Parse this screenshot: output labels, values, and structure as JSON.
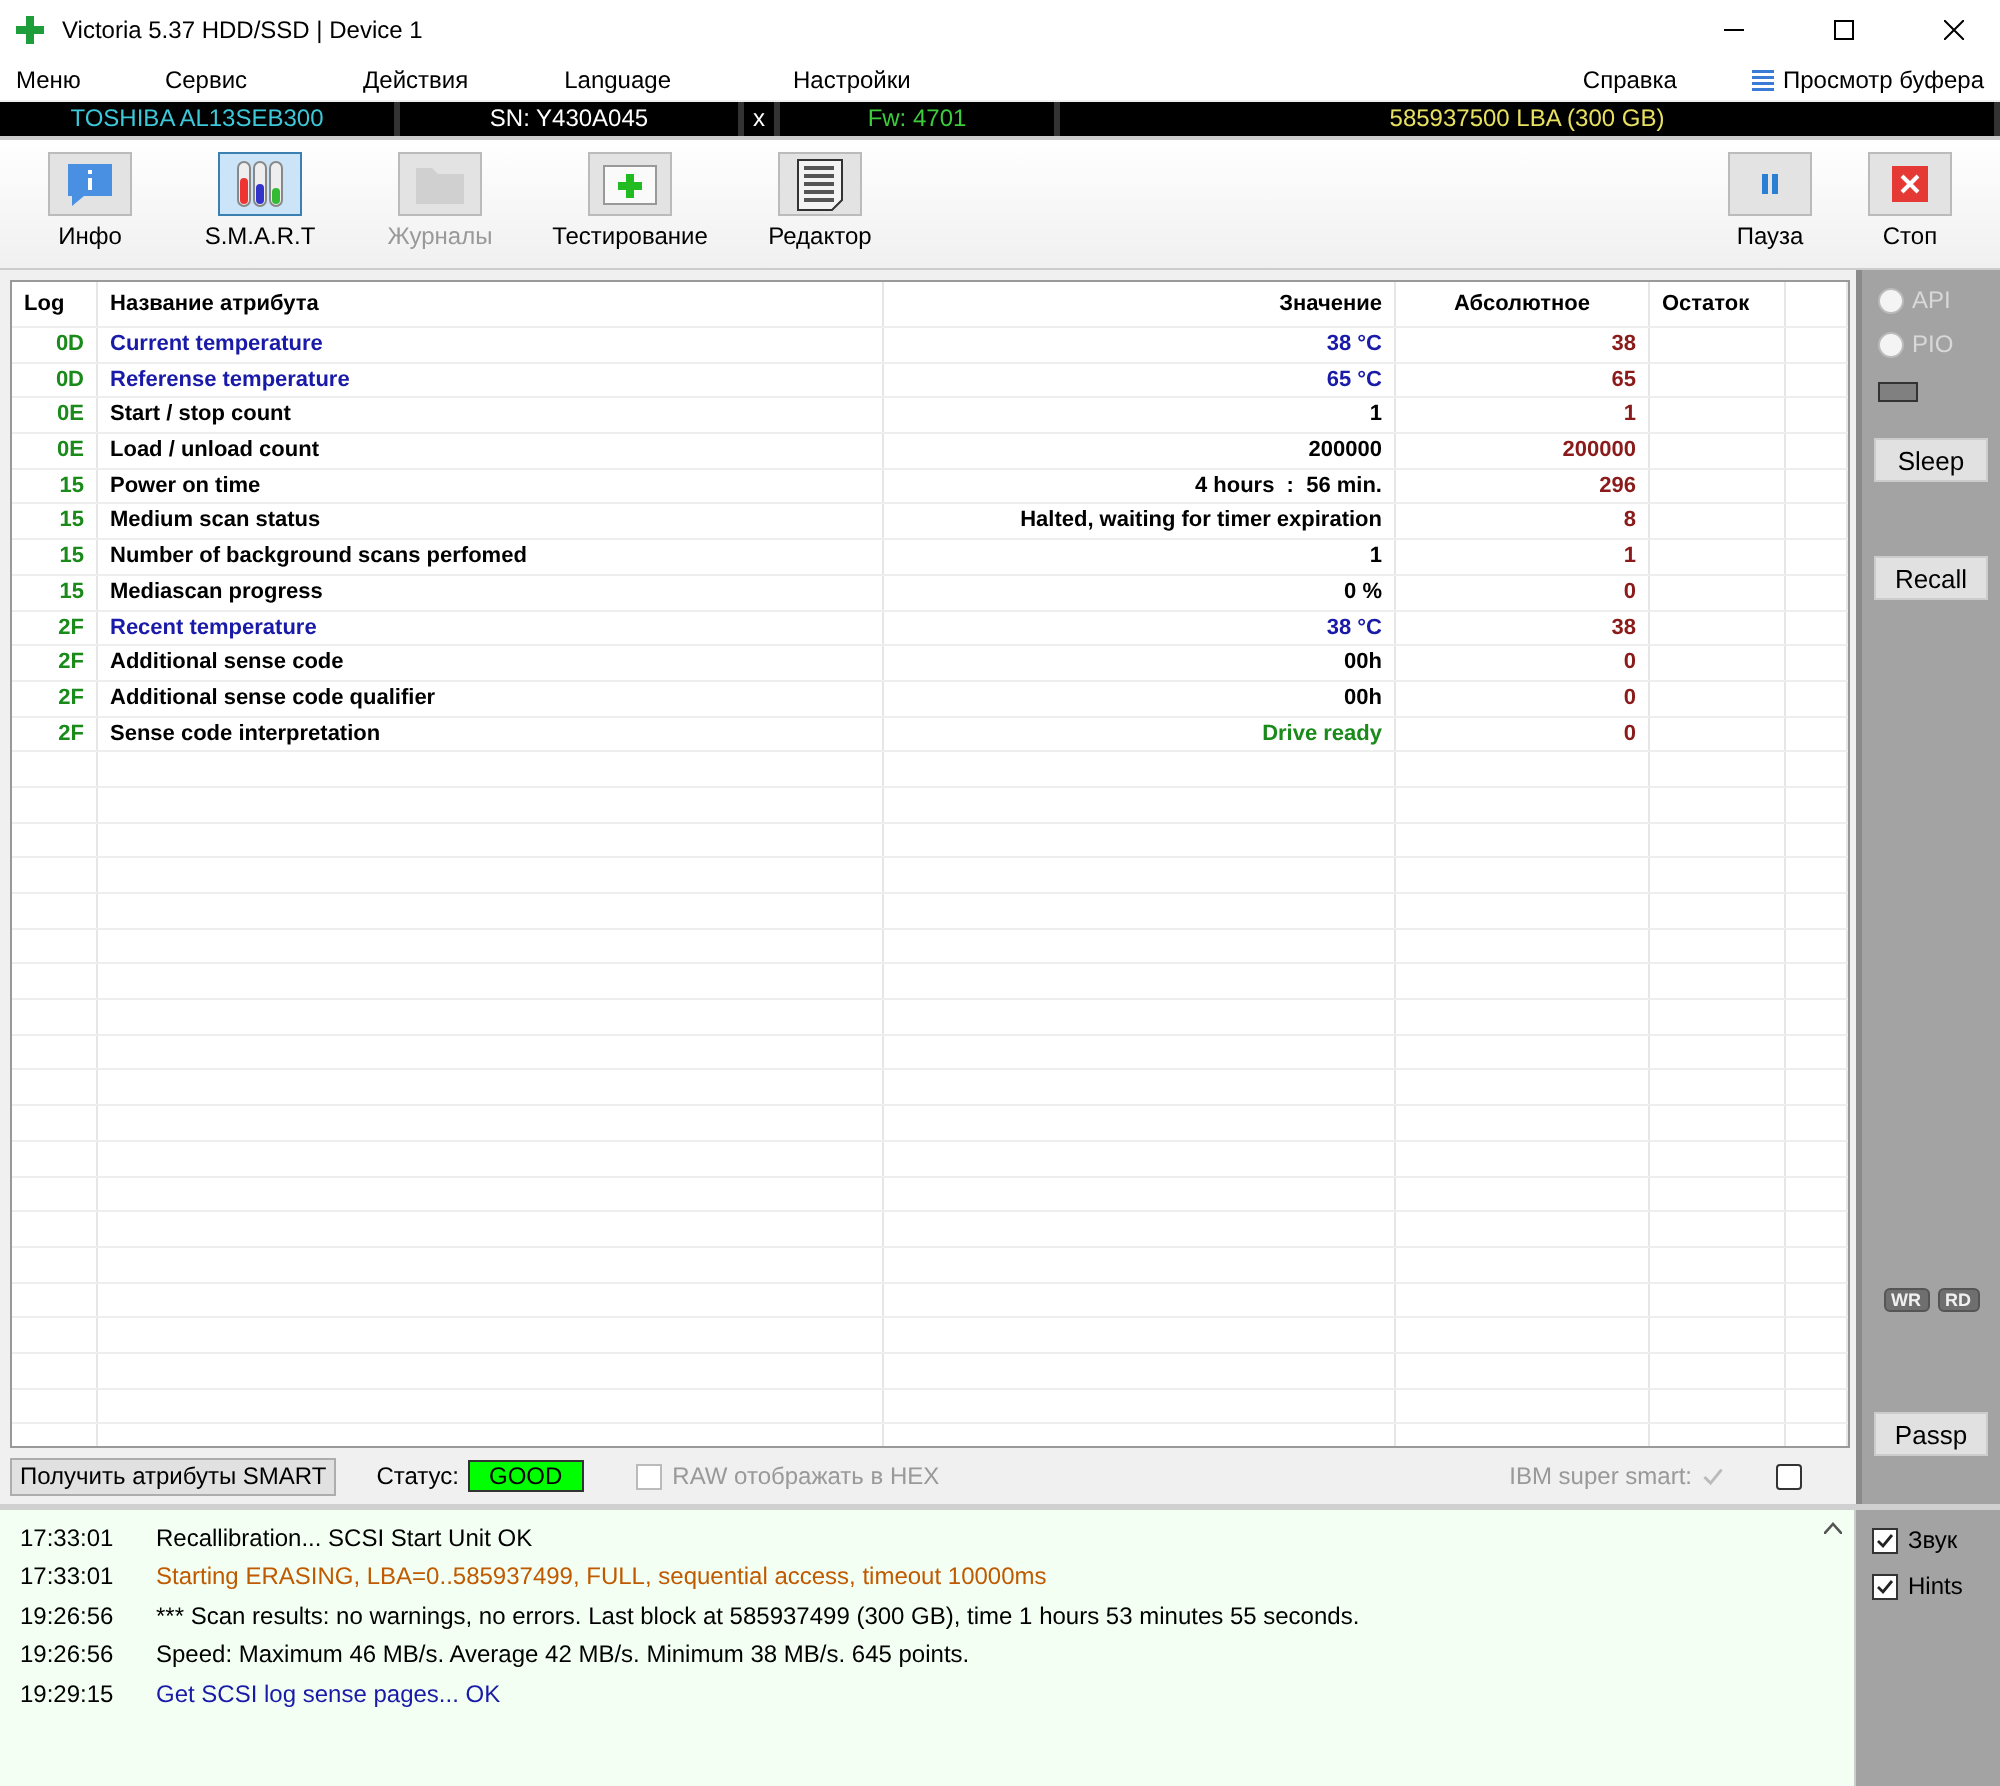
{
  "window": {
    "title": "Victoria 5.37 HDD/SSD | Device 1"
  },
  "menu": {
    "left": [
      "Меню",
      "Сервис",
      "Действия",
      "Language",
      "Настройки"
    ],
    "right": [
      "Справка"
    ],
    "buffer": "Просмотр буфера"
  },
  "device": {
    "model": "TOSHIBA AL13SEB300",
    "serial": "SN: Y430A045",
    "close": "x",
    "firmware": "Fw: 4701",
    "capacity": "585937500 LBA (300 GB)"
  },
  "toolbar": {
    "left": [
      {
        "label": "Инфо",
        "kind": "info",
        "selected": false,
        "disabled": false
      },
      {
        "label": "S.M.A.R.T",
        "kind": "smart",
        "selected": true,
        "disabled": false
      },
      {
        "label": "Журналы",
        "kind": "logs",
        "selected": false,
        "disabled": true
      },
      {
        "label": "Тестирование",
        "kind": "test",
        "selected": false,
        "disabled": false
      },
      {
        "label": "Редактор",
        "kind": "editor",
        "selected": false,
        "disabled": false
      }
    ],
    "right": [
      {
        "label": "Пауза",
        "kind": "pause",
        "selected": false,
        "disabled": false
      },
      {
        "label": "Стоп",
        "kind": "stop",
        "selected": false,
        "disabled": false
      }
    ]
  },
  "table": {
    "columns": [
      "Log",
      "Название атрибута",
      "Значение",
      "Абсолютное",
      "Остаток"
    ],
    "rows": [
      {
        "log": "0D",
        "name": "Current temperature",
        "value": "38 °C",
        "absolute": "38",
        "kind": "temperature"
      },
      {
        "log": "0D",
        "name": "Referense temperature",
        "value": "65 °C",
        "absolute": "65",
        "kind": "temperature"
      },
      {
        "log": "0E",
        "name": "Start / stop count",
        "value": "1",
        "absolute": "1",
        "kind": "normal"
      },
      {
        "log": "0E",
        "name": "Load / unload count",
        "value": "200000",
        "absolute": "200000",
        "kind": "normal"
      },
      {
        "log": "15",
        "name": "Power on time",
        "value": "4 hours  :  56 min.",
        "absolute": "296",
        "kind": "normal"
      },
      {
        "log": "15",
        "name": "Medium scan status",
        "value": "Halted, waiting for timer expiration",
        "absolute": "8",
        "kind": "normal"
      },
      {
        "log": "15",
        "name": "Number of background scans perfomed",
        "value": "1",
        "absolute": "1",
        "kind": "normal"
      },
      {
        "log": "15",
        "name": "Mediascan progress",
        "value": "0 %",
        "absolute": "0",
        "kind": "normal"
      },
      {
        "log": "2F",
        "name": "Recent temperature",
        "value": "38 °C",
        "absolute": "38",
        "kind": "temperature"
      },
      {
        "log": "2F",
        "name": "Additional sense code",
        "value": "00h",
        "absolute": "0",
        "kind": "normal"
      },
      {
        "log": "2F",
        "name": "Additional sense code qualifier",
        "value": "00h",
        "absolute": "0",
        "kind": "normal"
      },
      {
        "log": "2F",
        "name": "Sense code interpretation",
        "value": "Drive ready",
        "absolute": "0",
        "kind": "status"
      }
    ]
  },
  "status_strip": {
    "button": "Получить атрибуты SMART",
    "status_label": "Статус:",
    "status": "GOOD",
    "hex": {
      "label": "RAW отображать в HEX",
      "checked": false,
      "disabled": true
    },
    "ibm": {
      "label": "IBM super smart:",
      "checked": true,
      "disabled": true
    },
    "extra": {
      "checked": false
    }
  },
  "side_panel": {
    "modes": [
      {
        "label": "API",
        "selected": false,
        "disabled": true
      },
      {
        "label": "PIO",
        "selected": false,
        "disabled": true
      }
    ],
    "sleep": "Sleep",
    "recall": "Recall",
    "indicators": [
      "WR",
      "RD"
    ],
    "passp": "Passp"
  },
  "log": [
    {
      "time": "17:33:01",
      "text": "Recallibration... SCSI  Start Unit OK",
      "kind": "normal"
    },
    {
      "time": "17:33:01",
      "text": "Starting ERASING, LBA=0..585937499, FULL, sequential access, timeout 10000ms",
      "kind": "warning"
    },
    {
      "time": "19:26:56",
      "text": "*** Scan results: no warnings, no errors. Last block at 585937499 (300 GB), time 1 hours 53 minutes 55 seconds.",
      "kind": "normal"
    },
    {
      "time": "19:26:56",
      "text": "Speed: Maximum 46 MB/s. Average 42 MB/s. Minimum 38 MB/s. 645 points.",
      "kind": "normal"
    },
    {
      "time": "19:29:15",
      "text": "Get SCSI log sense pages... OK",
      "kind": "info"
    }
  ],
  "options": [
    {
      "label": "Звук",
      "checked": true
    },
    {
      "label": "Hints",
      "checked": true
    }
  ]
}
